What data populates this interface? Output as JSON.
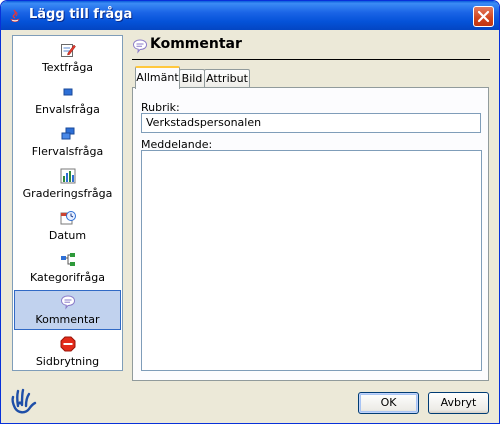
{
  "window": {
    "title": "Lägg till fråga"
  },
  "question_types": [
    {
      "label": "Textfråga",
      "icon": "text-edit-icon"
    },
    {
      "label": "Envalsfråga",
      "icon": "single-choice-icon"
    },
    {
      "label": "Flervalsfråga",
      "icon": "multi-choice-icon"
    },
    {
      "label": "Graderingsfråga",
      "icon": "rating-chart-icon"
    },
    {
      "label": "Datum",
      "icon": "clock-icon"
    },
    {
      "label": "Kategorifråga",
      "icon": "category-tree-icon"
    },
    {
      "label": "Kommentar",
      "icon": "comment-bubble-icon",
      "selected": true
    },
    {
      "label": "Sidbrytning",
      "icon": "stop-sign-icon"
    }
  ],
  "panel": {
    "title": "Kommentar",
    "tabs": [
      "Allmänt",
      "Bild",
      "Attribut"
    ],
    "active_tab": "Allmänt",
    "rubrik_label": "Rubrik:",
    "rubrik_value": "Verkstadspersonalen",
    "meddelande_label": "Meddelande:",
    "meddelande_value": ""
  },
  "buttons": {
    "ok": "OK",
    "cancel": "Avbryt"
  },
  "colors": {
    "titlebar": "#0553d9",
    "selection": "#c1d2ee",
    "dialog_bg": "#ece9d8",
    "tab_accent": "#ffc83c"
  }
}
